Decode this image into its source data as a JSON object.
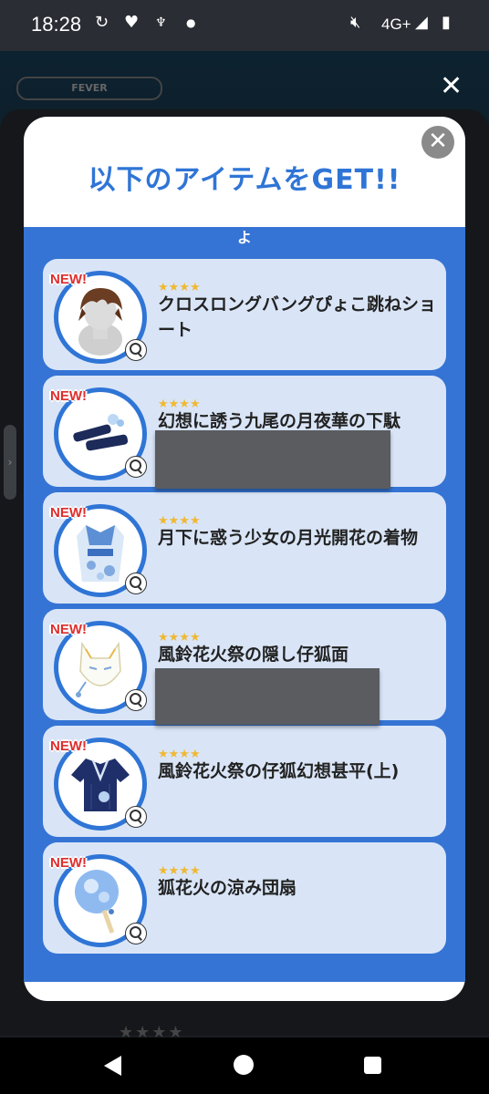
{
  "status_bar": {
    "time": "18:28",
    "network": "4G+",
    "icons": [
      "sync-icon",
      "heart-icon",
      "app-notification-icon",
      "dot-icon",
      "mute-icon",
      "signal-icon",
      "battery-charging-icon"
    ]
  },
  "background": {
    "fever_label": "FEVER",
    "close_label": "✕",
    "stars": "★★★★"
  },
  "modal": {
    "title": "以下のアイテムをGET!!",
    "close_label": "✕",
    "partial_text": "よ",
    "items": [
      {
        "badge": "NEW!",
        "stars": "★★★★",
        "name": "クロスロングバングぴょこ跳ねショート",
        "thumb": "hair-icon"
      },
      {
        "badge": "NEW!",
        "stars": "★★★★",
        "name": "幻想に誘う九尾の月夜華の下駄",
        "thumb": "geta-sandals-icon"
      },
      {
        "badge": "NEW!",
        "stars": "★★★★",
        "name": "月下に惑う少女の月光開花の着物",
        "thumb": "kimono-icon"
      },
      {
        "badge": "NEW!",
        "stars": "★★★★",
        "name": "風鈴花火祭の隠し仔狐面",
        "thumb": "fox-mask-icon"
      },
      {
        "badge": "NEW!",
        "stars": "★★★★",
        "name": "風鈴花火祭の仔狐幻想甚平(上)",
        "thumb": "jinbei-icon"
      },
      {
        "badge": "NEW!",
        "stars": "★★★★",
        "name": "狐花火の涼み団扇",
        "thumb": "uchiwa-fan-icon"
      }
    ]
  },
  "colors": {
    "accent_blue": "#2f75d6",
    "list_bg": "#3574d4",
    "card_bg": "#d9e5f7",
    "new_badge": "#e02d2d",
    "star": "#f0b832"
  }
}
